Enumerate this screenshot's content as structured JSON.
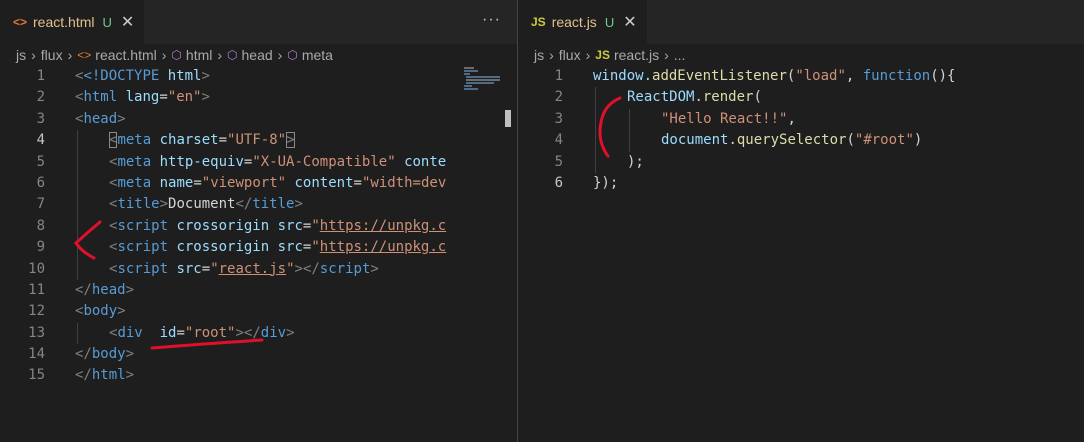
{
  "left_editor": {
    "tab": {
      "icon_text": "<>",
      "icon": "html-file-icon",
      "filename": "react.html",
      "status": "U",
      "close_icon": "close-icon"
    },
    "more_actions": "···",
    "breadcrumb": [
      "js",
      "flux",
      "react.html",
      "html",
      "head",
      "meta"
    ],
    "line_numbers": [
      "1",
      "2",
      "3",
      "4",
      "5",
      "6",
      "7",
      "8",
      "9",
      "10",
      "11",
      "12",
      "13",
      "14",
      "15"
    ],
    "active_line": 4
  },
  "right_editor": {
    "tab": {
      "icon_text": "JS",
      "filename": "react.js",
      "status": "U",
      "close_icon": "close-icon"
    },
    "breadcrumb": [
      "js",
      "flux",
      "react.js",
      "..."
    ],
    "line_numbers": [
      "1",
      "2",
      "3",
      "4",
      "5",
      "6"
    ],
    "active_line": 6
  },
  "html_code": {
    "l1_doctype": "<!DOCTYPE",
    "l1_html": "html",
    "l1_close": ">",
    "lt": "<",
    "gt": ">",
    "lts": "</",
    "eq": "=",
    "q": "\"",
    "tag_html": "html",
    "attr_lang": "lang",
    "val_en": "en",
    "tag_head": "head",
    "tag_meta": "meta",
    "attr_charset": "charset",
    "val_utf8": "UTF-8",
    "attr_http_equiv": "http-equiv",
    "val_xua": "X-UA-Compatible",
    "attr_content_trunc": "conte",
    "attr_name": "name",
    "val_viewport": "viewport",
    "attr_content": "content",
    "val_width_trunc": "width=dev",
    "tag_title": "title",
    "text_document": "Document",
    "tag_script": "script",
    "attr_crossorigin": "crossorigin",
    "attr_src": "src",
    "val_unpkg_trunc": "https://unpkg.c",
    "val_reactjs": "react.js",
    "tag_body": "body",
    "tag_div": "div",
    "attr_id": "id",
    "val_root": "root"
  },
  "js_code": {
    "l1_window": "window.",
    "l1_method": "addEventListener",
    "l1_paren": "(",
    "l1_load": "\"load\"",
    "l1_comma": ", ",
    "l1_function": "function",
    "l1_end": "(){",
    "l2_obj": "ReactDOM",
    "l2_dot": ".",
    "l2_method": "render",
    "l2_paren": "(",
    "l3_string": "\"Hello React!!\"",
    "l3_comma": ",",
    "l4_obj": "document",
    "l4_dot": ".",
    "l4_method": "querySelector",
    "l4_paren": "(",
    "l4_string": "\"#root\"",
    "l4_close": ")",
    "l5_close": ");",
    "l6_close": "});"
  },
  "colors": {
    "background": "#1e1e1e",
    "tag": "#569cd6",
    "attribute": "#9cdcfe",
    "string": "#ce9178",
    "function": "#dcdcaa",
    "untracked": "#73c991",
    "tab_modified_name": "#e2c08d",
    "annotation_ink": "#e0102a"
  }
}
